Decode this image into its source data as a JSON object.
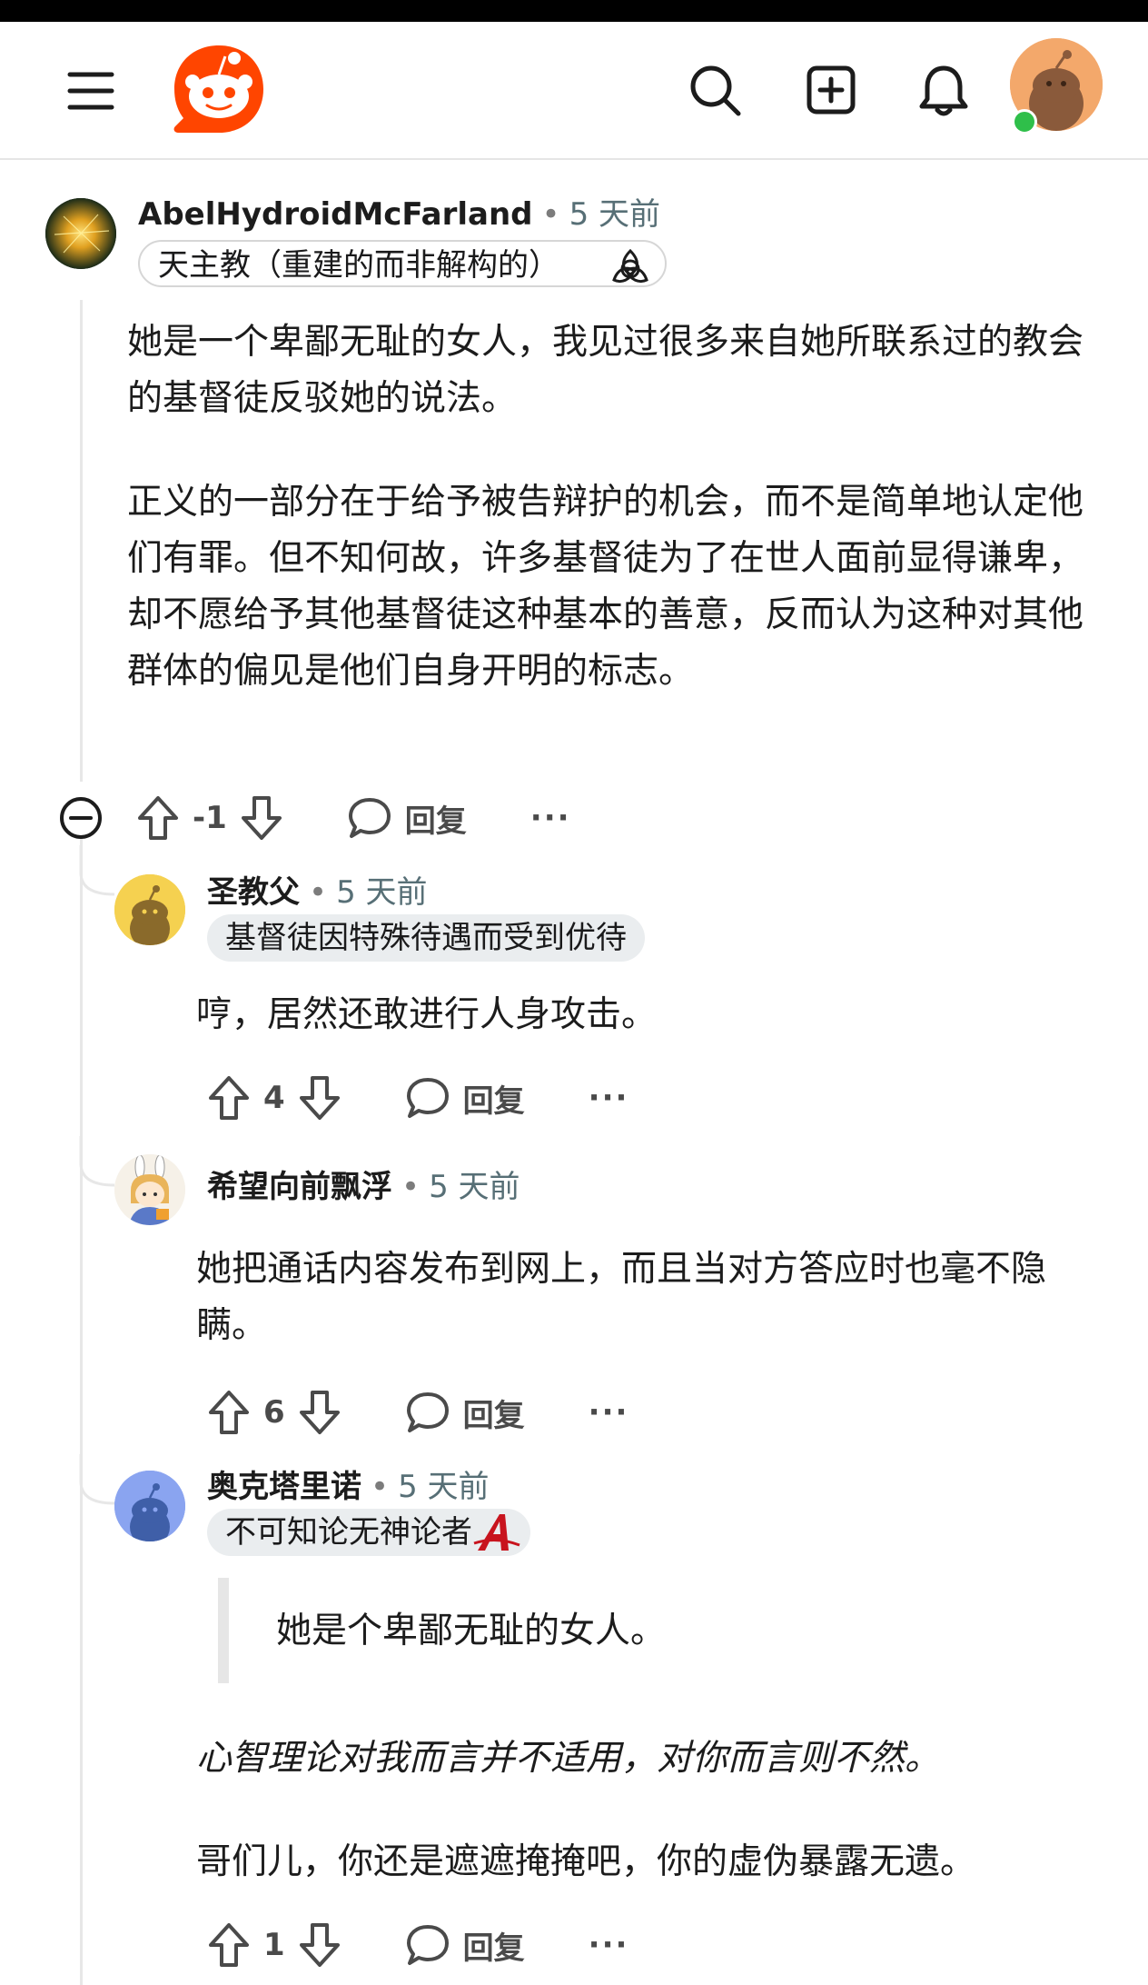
{
  "header": {
    "menu_icon": "hamburger-menu-icon",
    "logo_icon": "reddit-logo-icon",
    "search_icon": "search-icon",
    "create_icon": "create-post-icon",
    "bell_icon": "notification-bell-icon",
    "avatar_icon": "user-avatar",
    "brand_color": "#ff4500"
  },
  "comments": [
    {
      "username": "AbelHydroidMcFarland",
      "time": "5 天前",
      "flair": "天主教（重建的而非解构的）",
      "flair_icon": "trinity-knot-icon",
      "body_p1": "她是一个卑鄙无耻的女人，我见过很多来自她所联系过的教会的基督徒反驳她的说法。",
      "body_p2": "正义的一部分在于给予被告辩护的机会，而不是简单地认定他们有罪。但不知何故，许多基督徒为了在世人面前显得谦卑，却不愿给予其他基督徒这种基本的善意，反而认为这种对其他群体的偏见是他们自身开明的标志。",
      "score": "-1",
      "reply_label": "回复",
      "more": "···"
    },
    {
      "username": "圣教父",
      "time": "5 天前",
      "flair": "基督徒因特殊待遇而受到优待",
      "body": "哼，居然还敢进行人身攻击。",
      "score": "4",
      "reply_label": "回复",
      "more": "···"
    },
    {
      "username": "希望向前飘浮",
      "time": "5 天前",
      "body": "她把通话内容发布到网上，而且当对方答应时也毫不隐瞒。",
      "score": "6",
      "reply_label": "回复",
      "more": "···"
    },
    {
      "username": "奥克塔里诺",
      "time": "5 天前",
      "flair": "不可知论无神论者",
      "flair_icon": "atheist-a-icon",
      "quote": "她是个卑鄙无耻的女人。",
      "body_italic": "心智理论对我而言并不适用，对你而言则不然。",
      "body": "哥们儿，你还是遮遮掩掩吧，你的虚伪暴露无遗。",
      "score": "1",
      "reply_label": "回复",
      "more": "···"
    }
  ]
}
